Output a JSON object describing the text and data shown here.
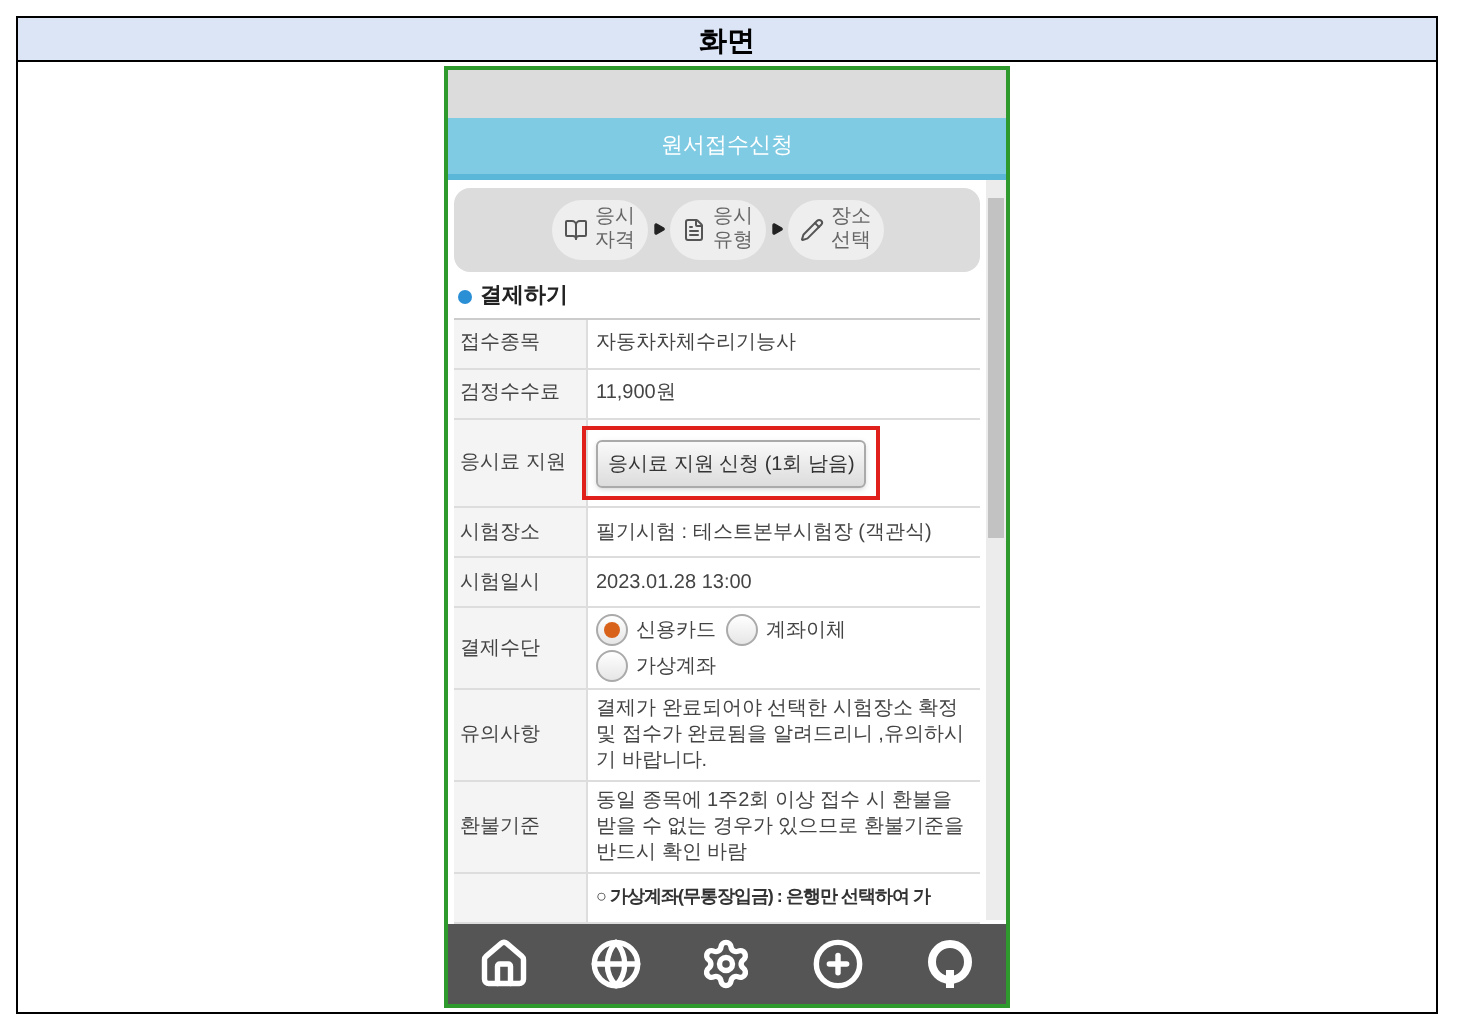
{
  "page_heading": "화면",
  "app": {
    "title": "원서접수신청",
    "steps": [
      {
        "label": "응시\n자격",
        "kind": "book"
      },
      {
        "label": "응시\n유형",
        "kind": "doc"
      },
      {
        "label": "장소\n선택",
        "kind": "pencil"
      }
    ],
    "section_title": "결제하기",
    "rows": [
      {
        "label": "접수종목",
        "kind": "text",
        "value": "자동차차체수리기능사"
      },
      {
        "label": "검정수수료",
        "kind": "text",
        "value": "11,900원"
      },
      {
        "label": "응시료 지원",
        "kind": "button",
        "value": "응시료 지원 신청 (1회 남음)",
        "highlighted": true
      },
      {
        "label": "시험장소",
        "kind": "text",
        "value": "필기시험 : 테스트본부시험장 (객관식)"
      },
      {
        "label": "시험일시",
        "kind": "text",
        "value": "2023.01.28 13:00"
      },
      {
        "label": "결제수단",
        "kind": "radio",
        "options": [
          {
            "label": "신용카드",
            "selected": true
          },
          {
            "label": "계좌이체",
            "selected": false
          },
          {
            "label": "가상계좌",
            "selected": false
          }
        ]
      },
      {
        "label": "유의사항",
        "kind": "text",
        "value": "결제가 완료되어야 선택한 시험장소 확정 및 접수가 완료됨을 알려드리니 ,유의하시기 바랍니다."
      },
      {
        "label": "환불기준",
        "kind": "text",
        "value": "동일 종목에 1주2회 이상 접수 시 환불을 받을 수 없는 경우가 있으므로 환불기준을 반드시 확인 바람"
      },
      {
        "label": "",
        "kind": "note",
        "value": "○ **가상계좌(무통장입금) : 은행만 선택하여 가**"
      }
    ],
    "nav": [
      {
        "kind": "home"
      },
      {
        "kind": "globe"
      },
      {
        "kind": "gear"
      },
      {
        "kind": "plus"
      },
      {
        "kind": "cloud"
      }
    ]
  }
}
